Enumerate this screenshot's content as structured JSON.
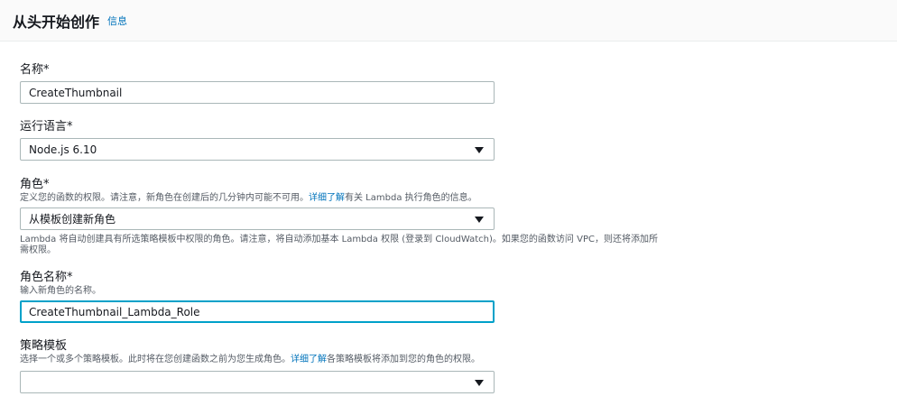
{
  "header": {
    "title": "从头开始创作",
    "info_link": "信息"
  },
  "fields": {
    "name": {
      "label": "名称*",
      "value": "CreateThumbnail"
    },
    "runtime": {
      "label": "运行语言*",
      "value": "Node.js 6.10"
    },
    "role": {
      "label": "角色*",
      "desc_prefix": "定义您的函数的权限。请注意，新角色在创建后的几分钟内可能不可用。",
      "desc_link": "详细了解",
      "desc_suffix": "有关 Lambda 执行角色的信息。",
      "value": "从模板创建新角色",
      "note": "Lambda 将自动创建具有所选策略模板中权限的角色。请注意，将自动添加基本 Lambda 权限 (登录到 CloudWatch)。如果您的函数访问 VPC，则还将添加所需权限。"
    },
    "role_name": {
      "label": "角色名称*",
      "desc": "输入新角色的名称。",
      "value": "CreateThumbnail_Lambda_Role"
    },
    "policy_templates": {
      "label": "策略模板",
      "desc_prefix": "选择一个或多个策略模板。此时将在您创建函数之前为您生成角色。",
      "desc_link": "详细了解",
      "desc_suffix": "各策略模板将添加到您的角色的权限。",
      "value": ""
    }
  },
  "icons": {
    "dropdown": "caret-down-icon"
  },
  "colors": {
    "link": "#0073bb",
    "focus": "#00a1c9",
    "border": "#aab7b8"
  }
}
